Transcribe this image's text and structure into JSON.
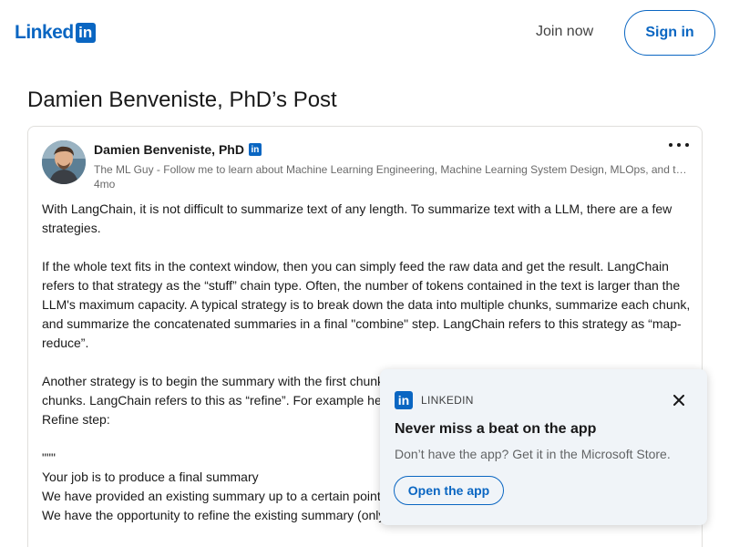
{
  "header": {
    "logo_text": "Linked",
    "logo_in": "in",
    "join_label": "Join now",
    "signin_label": "Sign in"
  },
  "page_title": "Damien Benveniste, PhD’s Post",
  "post": {
    "author_name": "Damien Benveniste, PhD",
    "badge": "in",
    "headline": "The ML Guy - Follow me to learn about Machine Learning Engineering, Machine Learning System Design, MLOps, and the latest techniques and news about the field.",
    "time": "4mo",
    "paragraphs": [
      "With LangChain, it is not difficult to summarize text of any length. To summarize text with a LLM, there are a few strategies.",
      "If the whole text fits in the context window, then you can simply feed the raw data and get the result. LangChain refers to that strategy as the “stuff” chain type. Often, the number of tokens contained in the text is larger than the LLM's maximum capacity. A typical strategy is to break down the data into multiple chunks, summarize each chunk, and summarize the concatenated summaries in a final \"combine\" step. LangChain refers to this strategy as “map-reduce”.",
      "Another strategy is to begin the summary with the first chunk and refine it little by little with each of the following chunks. LangChain refers to this as “refine”. For example here is the prompt template used by LangChain for the Refine step:",
      "\"\"\"\nYour job is to produce a final summary\nWe have provided an existing summary up to a certain point: {existing_answer}\nWe have the opportunity to refine the existing summary (only if needed) with some more context below."
    ]
  },
  "toast": {
    "brand": "LINKEDIN",
    "logo_in": "in",
    "title": "Never miss a beat on the app",
    "subtitle": "Don’t have the app? Get it in the Microsoft Store.",
    "button_label": "Open the app"
  },
  "colors": {
    "brand": "#0a66c2",
    "toast_bg": "#f0f4f8"
  },
  "icons": [
    "linkedin-logo",
    "linkedin-badge-icon",
    "more-options-icon",
    "close-icon"
  ]
}
